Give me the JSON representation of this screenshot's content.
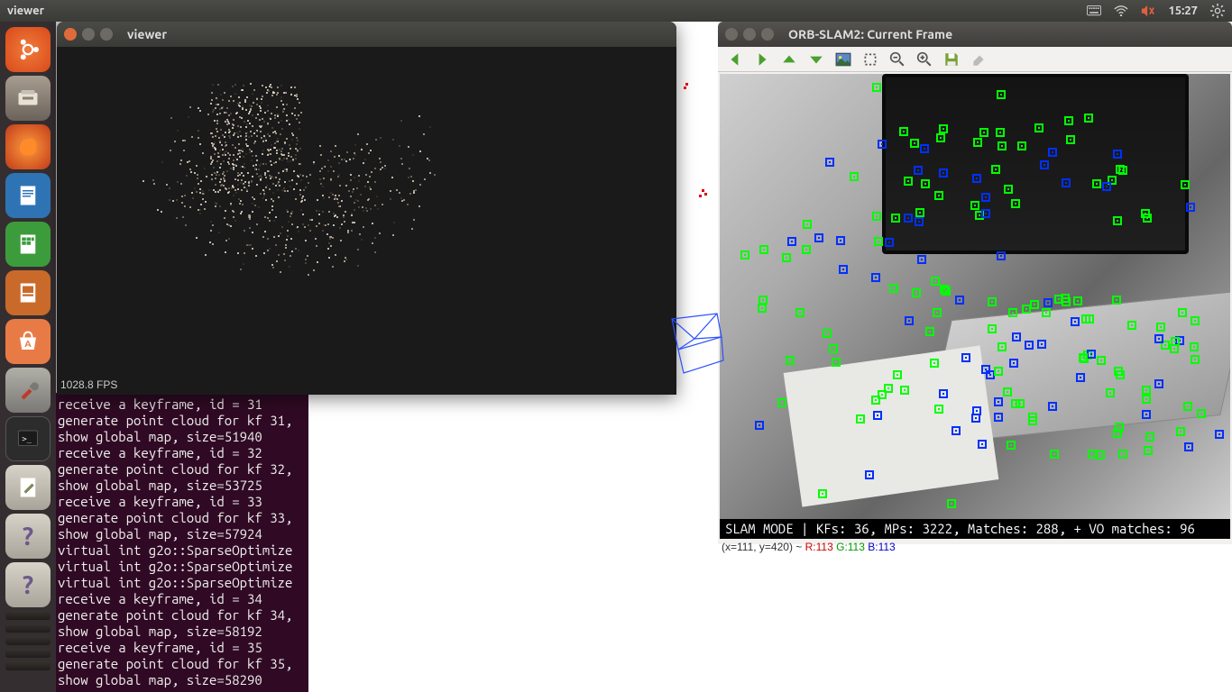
{
  "menubar": {
    "app_title": "viewer",
    "time": "15:27"
  },
  "launcher": {
    "items": [
      {
        "name": "dash-icon"
      },
      {
        "name": "files-icon"
      },
      {
        "name": "firefox-icon"
      },
      {
        "name": "writer-icon"
      },
      {
        "name": "calc-icon"
      },
      {
        "name": "impress-icon"
      },
      {
        "name": "software-icon"
      },
      {
        "name": "settings-tool-icon"
      },
      {
        "name": "terminal-icon"
      },
      {
        "name": "text-editor-icon"
      },
      {
        "name": "help-icon"
      },
      {
        "name": "help-icon"
      }
    ]
  },
  "viewer_window": {
    "title": "viewer",
    "fps_text": "1028.8 FPS"
  },
  "slam_window": {
    "title": "ORB-SLAM2: Current Frame",
    "status_prefix": "SLAM MODE | ",
    "kfs_label": "KFs:",
    "kfs_value": "36",
    "mps_label": "MPs:",
    "mps_value": "3222",
    "matches_label": "Matches:",
    "matches_value": "288",
    "vo_label": "+ VO matches:",
    "vo_value": "96",
    "coords_text": "(x=111, y=420) ~ ",
    "coords_r": "R:113",
    "coords_g": "G:113",
    "coords_b": "B:113"
  },
  "terminal": {
    "lines": [
      "receive a keyframe, id = 31",
      "generate point cloud for kf 31,",
      "show global map, size=51940",
      "receive a keyframe, id = 32",
      "generate point cloud for kf 32,",
      "show global map, size=53725",
      "receive a keyframe, id = 33",
      "generate point cloud for kf 33,",
      "show global map, size=57924",
      "virtual int g2o::SparseOptimize",
      "virtual int g2o::SparseOptimize",
      "virtual int g2o::SparseOptimize",
      "receive a keyframe, id = 34",
      "generate point cloud for kf 34,",
      "show global map, size=58192",
      "receive a keyframe, id = 35",
      "generate point cloud for kf 35,",
      "show global map, size=58290",
      "▯"
    ]
  }
}
